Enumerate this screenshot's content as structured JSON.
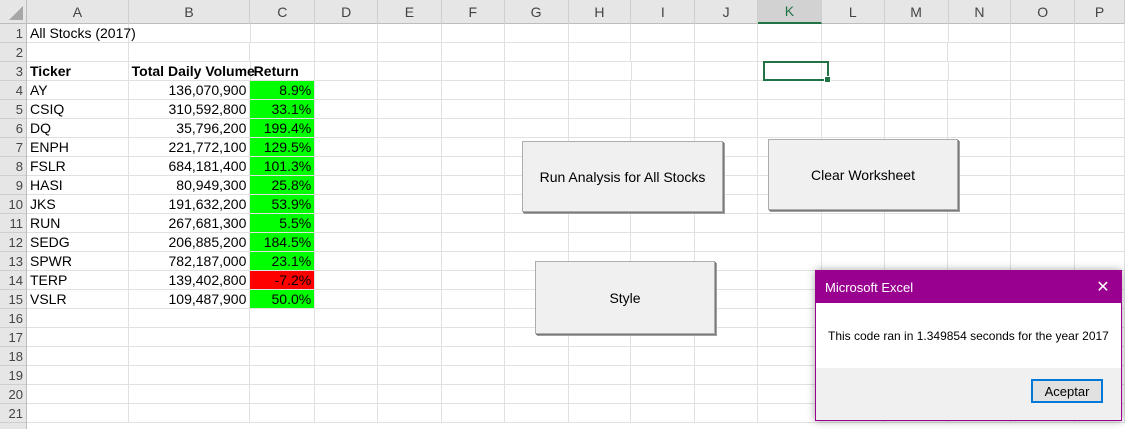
{
  "columns": [
    {
      "letter": "A",
      "w": 102
    },
    {
      "letter": "B",
      "w": 122
    },
    {
      "letter": "C",
      "w": 65
    },
    {
      "letter": "D",
      "w": 63
    },
    {
      "letter": "E",
      "w": 64
    },
    {
      "letter": "F",
      "w": 63
    },
    {
      "letter": "G",
      "w": 64
    },
    {
      "letter": "H",
      "w": 63
    },
    {
      "letter": "I",
      "w": 64
    },
    {
      "letter": "J",
      "w": 63
    },
    {
      "letter": "K",
      "w": 64
    },
    {
      "letter": "L",
      "w": 63
    },
    {
      "letter": "M",
      "w": 64
    },
    {
      "letter": "N",
      "w": 63
    },
    {
      "letter": "O",
      "w": 64
    },
    {
      "letter": "P",
      "w": 50
    }
  ],
  "selected_column": "K",
  "rows": [
    "1",
    "2",
    "3",
    "4",
    "5",
    "6",
    "7",
    "8",
    "9",
    "10",
    "11",
    "12",
    "13",
    "14",
    "15",
    "16",
    "17",
    "18",
    "19",
    "20",
    "21"
  ],
  "sheet": {
    "title": "All Stocks (2017)",
    "headers": [
      "Ticker",
      "Total Daily Volume",
      "Return"
    ],
    "data": [
      {
        "ticker": "AY",
        "volume": "136,070,900",
        "ret": "8.9%",
        "status": "positive"
      },
      {
        "ticker": "CSIQ",
        "volume": "310,592,800",
        "ret": "33.1%",
        "status": "positive"
      },
      {
        "ticker": "DQ",
        "volume": "35,796,200",
        "ret": "199.4%",
        "status": "positive"
      },
      {
        "ticker": "ENPH",
        "volume": "221,772,100",
        "ret": "129.5%",
        "status": "positive"
      },
      {
        "ticker": "FSLR",
        "volume": "684,181,400",
        "ret": "101.3%",
        "status": "positive"
      },
      {
        "ticker": "HASI",
        "volume": "80,949,300",
        "ret": "25.8%",
        "status": "positive"
      },
      {
        "ticker": "JKS",
        "volume": "191,632,200",
        "ret": "53.9%",
        "status": "positive"
      },
      {
        "ticker": "RUN",
        "volume": "267,681,300",
        "ret": "5.5%",
        "status": "positive"
      },
      {
        "ticker": "SEDG",
        "volume": "206,885,200",
        "ret": "184.5%",
        "status": "positive"
      },
      {
        "ticker": "SPWR",
        "volume": "782,187,000",
        "ret": "23.1%",
        "status": "positive"
      },
      {
        "ticker": "TERP",
        "volume": "139,402,800",
        "ret": "-7.2%",
        "status": "negative"
      },
      {
        "ticker": "VSLR",
        "volume": "109,487,900",
        "ret": "50.0%",
        "status": "positive"
      }
    ]
  },
  "colors": {
    "positive": "#00ff00",
    "negative": "#ff0000",
    "dialog_title": "#99008f",
    "excel_green": "#217346"
  },
  "buttons": {
    "run_all": "Run Analysis for All Stocks",
    "clear": "Clear Worksheet",
    "style": "Style"
  },
  "dialog": {
    "title": "Microsoft Excel",
    "close_icon": "close-icon",
    "message": "This code ran in 1.349854 seconds for the year 2017",
    "ok": "Aceptar"
  }
}
